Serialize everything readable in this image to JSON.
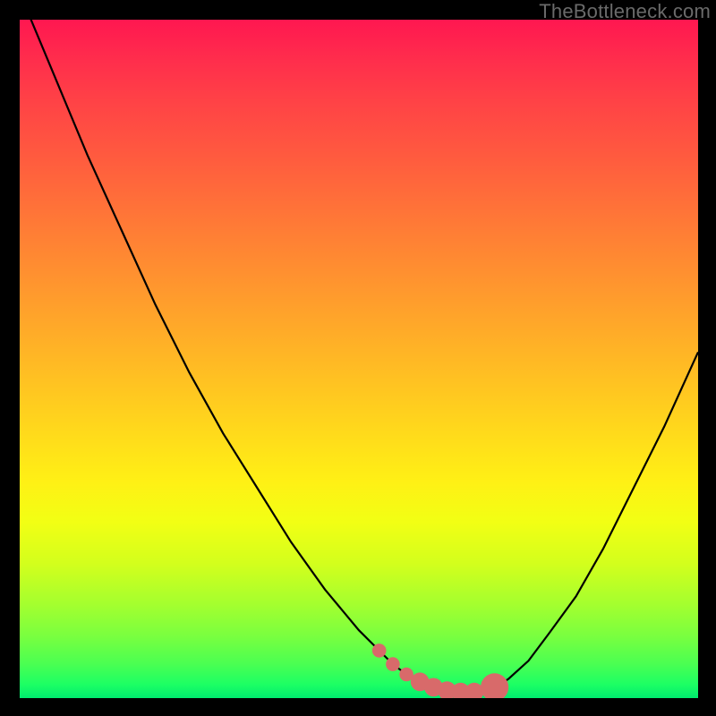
{
  "watermark": "TheBottleneck.com",
  "colors": {
    "frame": "#000000",
    "curve_stroke": "#000000",
    "marker_fill": "#d86a6a",
    "marker_stroke": "#b24b4b",
    "gradient_top": "#ff1750",
    "gradient_bottom": "#00eb6e"
  },
  "chart_data": {
    "type": "line",
    "title": "",
    "xlabel": "",
    "ylabel": "",
    "xlim": [
      0,
      100
    ],
    "ylim": [
      0,
      100
    ],
    "x": [
      0,
      5,
      10,
      15,
      20,
      25,
      30,
      35,
      40,
      45,
      50,
      53,
      55,
      57,
      59,
      61,
      63,
      65,
      67,
      69,
      70,
      72,
      75,
      78,
      82,
      86,
      90,
      95,
      100
    ],
    "y": [
      104,
      92,
      80,
      69,
      58,
      48,
      39,
      31,
      23,
      16,
      10,
      7,
      5,
      3.5,
      2.4,
      1.6,
      1.1,
      0.9,
      0.9,
      1.2,
      1.6,
      2.8,
      5.5,
      9.5,
      15,
      22,
      30,
      40,
      51
    ],
    "markers": {
      "x": [
        53,
        55,
        57,
        59,
        61,
        63,
        65,
        67,
        69,
        70
      ],
      "y": [
        7,
        5,
        3.5,
        2.4,
        1.6,
        1.1,
        0.9,
        0.9,
        1.2,
        1.6
      ],
      "sizes": [
        3,
        3,
        3,
        4,
        4,
        4,
        4,
        4,
        3,
        6
      ]
    }
  }
}
